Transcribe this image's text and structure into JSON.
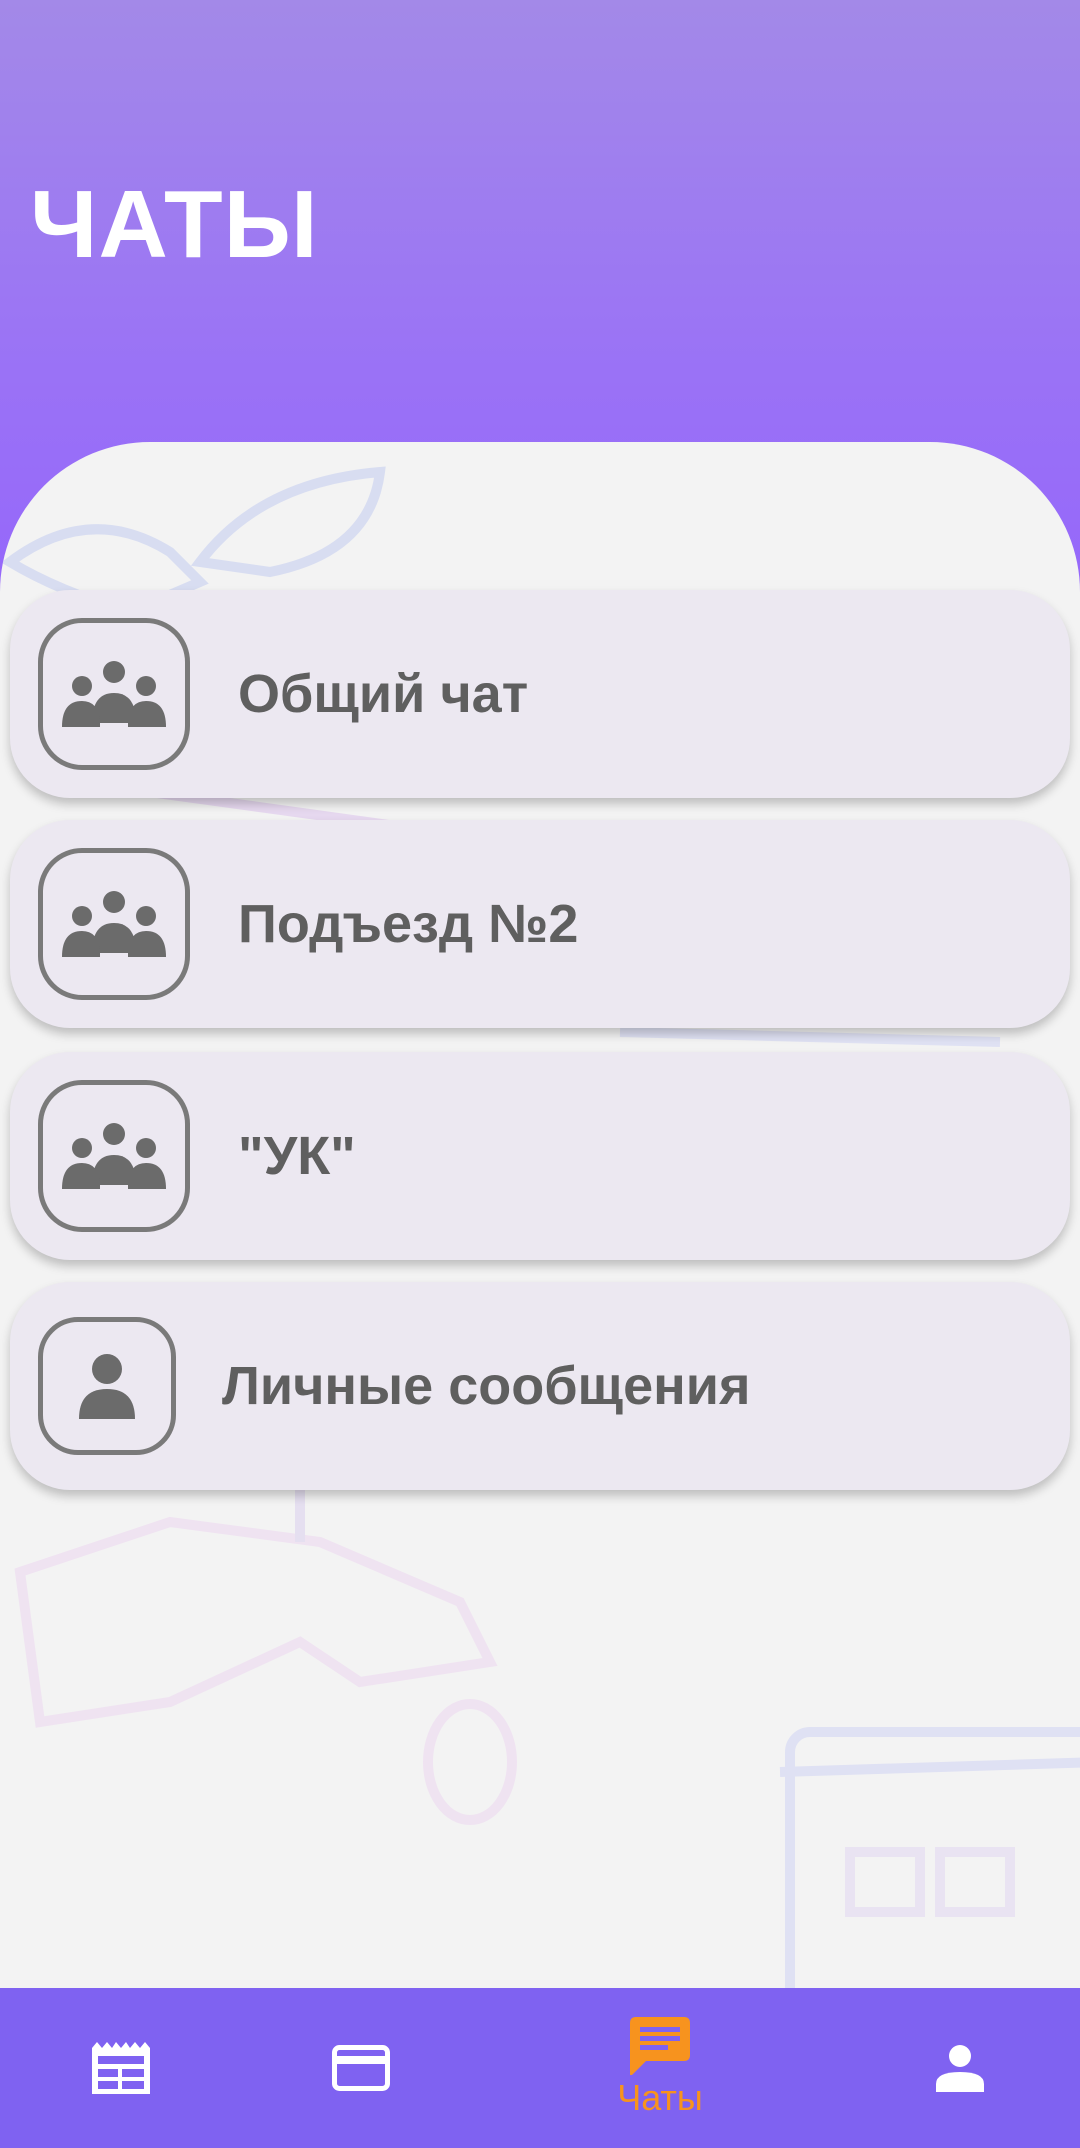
{
  "header": {
    "title": "ЧАТЫ"
  },
  "chats": [
    {
      "label": "Общий чат",
      "icon": "group-icon"
    },
    {
      "label": "Подъезд №2",
      "icon": "group-icon"
    },
    {
      "label": "\"УК\"",
      "icon": "group-icon"
    },
    {
      "label": "Личные сообщения",
      "icon": "person-icon"
    }
  ],
  "bottom_nav": {
    "items": [
      {
        "icon": "news-icon",
        "label": ""
      },
      {
        "icon": "payment-card-icon",
        "label": ""
      },
      {
        "icon": "chat-icon",
        "label": "Чаты",
        "active": true
      },
      {
        "icon": "profile-icon",
        "label": ""
      }
    ]
  },
  "colors": {
    "header_gradient_top": "#a389e8",
    "header_gradient_bottom": "#9566fb",
    "nav_background": "#7f62f1",
    "nav_active": "#f7931e",
    "card_background": "#ece8f1",
    "text_gray": "#5f5f5f"
  }
}
